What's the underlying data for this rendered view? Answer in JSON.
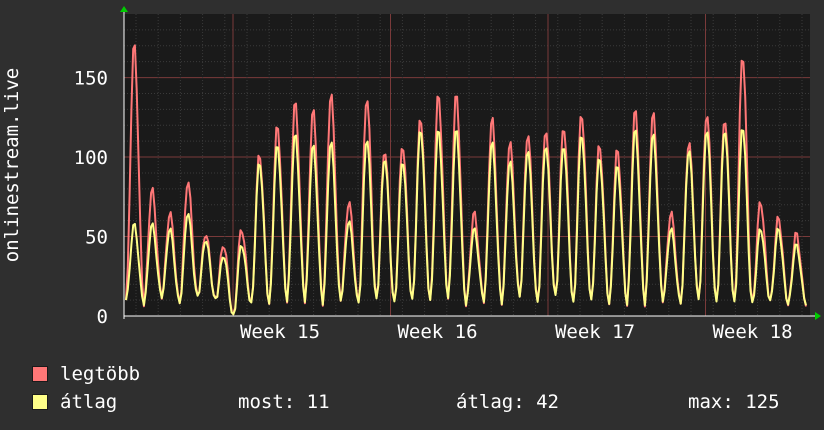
{
  "chart_data": {
    "type": "line",
    "ylabel": "onlinestream.live",
    "ylim": [
      0,
      190
    ],
    "yticks": [
      0,
      50,
      100,
      150
    ],
    "xticks": [
      "Week 15",
      "Week 16",
      "Week 17",
      "Week 18"
    ],
    "grid": true,
    "background": "#1a1a1a",
    "series": [
      {
        "name": "legtöbb",
        "color": "#ff7777",
        "peaks": [
          172,
          80,
          65,
          85,
          52,
          45,
          55,
          102,
          120,
          135,
          130,
          140,
          72,
          138,
          105,
          108,
          125,
          140,
          140,
          65,
          125,
          110,
          115,
          118,
          120,
          128,
          108,
          105,
          130,
          128,
          65,
          110,
          128,
          125,
          165,
          72,
          62,
          52
        ],
        "troughs": [
          10,
          8,
          12,
          8,
          12,
          10,
          0,
          8,
          8,
          10,
          10,
          8,
          10,
          8,
          10,
          8,
          10,
          10,
          12,
          8,
          10,
          8,
          12,
          8,
          12,
          8,
          10,
          8,
          8,
          8,
          10,
          8,
          10,
          8,
          8,
          8,
          10,
          8
        ]
      },
      {
        "name": "átlag",
        "color": "#ffff88",
        "peaks": [
          58,
          58,
          55,
          65,
          48,
          38,
          45,
          97,
          108,
          115,
          108,
          110,
          60,
          112,
          100,
          98,
          118,
          118,
          118,
          55,
          110,
          98,
          105,
          108,
          108,
          115,
          100,
          95,
          118,
          115,
          55,
          105,
          118,
          118,
          120,
          55,
          55,
          45
        ],
        "troughs": [
          10,
          8,
          12,
          8,
          12,
          10,
          0,
          8,
          8,
          10,
          10,
          8,
          10,
          8,
          10,
          8,
          10,
          10,
          12,
          8,
          10,
          8,
          12,
          8,
          12,
          8,
          10,
          8,
          8,
          8,
          10,
          8,
          10,
          8,
          8,
          8,
          10,
          8
        ]
      }
    ]
  },
  "legend": {
    "max_label": "legtöbb",
    "avg_label": "átlag",
    "max_color": "#ff7777",
    "avg_color": "#ffff88"
  },
  "stats": {
    "now": "most: 11",
    "avg": "átlag: 42",
    "max": "max: 125"
  }
}
